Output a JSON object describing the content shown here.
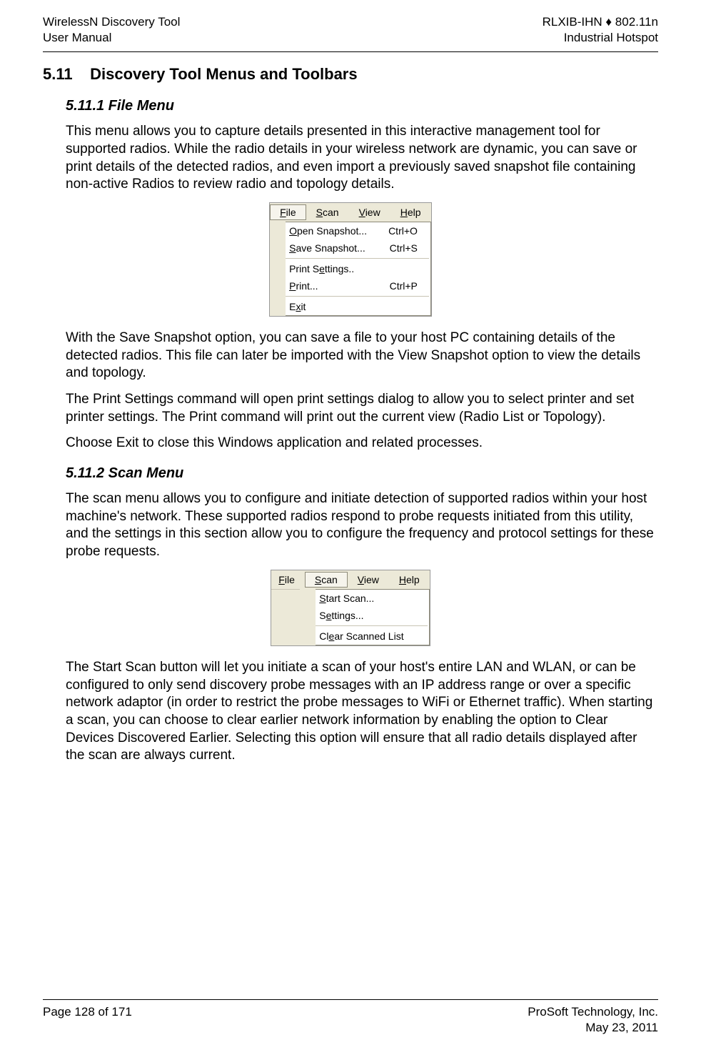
{
  "header": {
    "left_line1": "WirelessN Discovery Tool",
    "left_line2": "User Manual",
    "right_line1": "RLXIB-IHN ♦ 802.11n",
    "right_line2": "Industrial Hotspot"
  },
  "section": {
    "number": "5.11",
    "title": "Discovery Tool Menus and Toolbars"
  },
  "sub1": {
    "heading": "5.11.1 File Menu",
    "p1": "This menu allows you to capture details presented in this interactive management tool for supported radios. While the radio details in your wireless network are dynamic, you can save or print details of the detected radios, and even import a previously saved snapshot file containing non-active Radios to review radio and topology details.",
    "p2": "With the Save Snapshot option, you can save a file to your host PC containing details of the detected radios. This file can later be imported with the View Snapshot option to view the details and topology.",
    "p3": "The Print Settings command will open print settings dialog to allow you to select printer and set printer settings. The Print command will print out the current view (Radio List or Topology).",
    "p4": "Choose Exit to close this Windows application and related processes."
  },
  "menubar": {
    "file": "File",
    "scan": "Scan",
    "view": "View",
    "help": "Help"
  },
  "file_menu": {
    "open_snapshot": "Open Snapshot...",
    "open_shortcut": "Ctrl+O",
    "save_snapshot": "Save Snapshot...",
    "save_shortcut": "Ctrl+S",
    "print_settings": "Print Settings..",
    "print": "Print...",
    "print_shortcut": "Ctrl+P",
    "exit": "Exit"
  },
  "sub2": {
    "heading": "5.11.2 Scan Menu",
    "p1": "The scan menu allows you to configure and initiate detection of supported radios within your host machine's network. These supported radios respond to probe requests initiated from this utility, and the settings in this section allow you to configure the frequency and protocol settings for these probe requests.",
    "p2": "The Start Scan button will let you initiate a scan of your host's entire LAN and WLAN, or can be configured to only send discovery probe messages with an IP address range or over a specific network adaptor (in order to restrict the probe messages to WiFi or Ethernet traffic). When starting a scan, you can choose to clear earlier network information by enabling the option to Clear Devices Discovered Earlier. Selecting this option will ensure that all radio details displayed after the scan are always current."
  },
  "scan_menu": {
    "start_scan": "Start Scan...",
    "settings": "Settings...",
    "clear": "Clear Scanned List"
  },
  "footer": {
    "page": "Page 128 of 171",
    "company": "ProSoft Technology, Inc.",
    "date": "May 23, 2011"
  }
}
